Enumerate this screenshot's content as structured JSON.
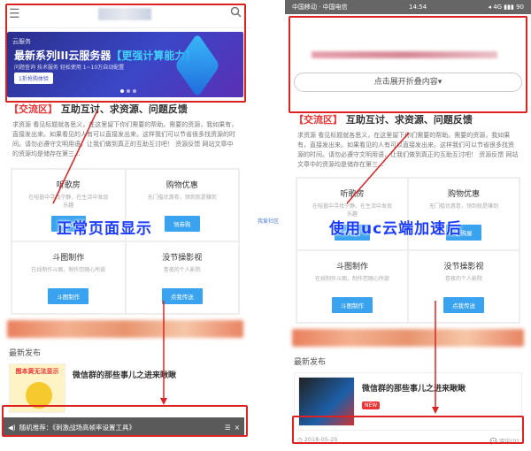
{
  "left": {
    "banner": {
      "logo": "云服务",
      "title_main": "最新系列III云服务器",
      "title_hl": "【更强计算能力】",
      "sub": "问题查询 技术服务 轻松使用 1~10万自动配置",
      "button": "1折抢购体验"
    },
    "section": {
      "tag": "【交流区】",
      "title": "互助互讨、求资源、问题反馈"
    },
    "description": "求资源 看见标题就各思义，在这里留下你们需要的帮助。需要的资源，我如果有，直接发出来。如果看见的人有可以直接发出来。这样我们可以节省很多找资源的时间。请勿必遵守文明用语，让我们做到真正的互助互讨吧！ 资源反馈 网站文章中的资源均是储存在第三...",
    "grid": [
      {
        "title": "听歌房",
        "desc": "在喧嚣中寻找宁静，在生活中发现乐趣",
        "button": "听歌房"
      },
      {
        "title": "购物优惠",
        "desc": "无门槛优惠卷，领到就是赚到",
        "button": "领券购"
      },
      {
        "title": "斗图制作",
        "desc": "在线制作斗图，制作您随心所欲",
        "button": "斗图制作"
      },
      {
        "title": "没节操影视",
        "desc": "卷夜的个人影院",
        "button": "点我传送"
      }
    ],
    "overlay": "正常页面显示",
    "latest_label": "最新发布",
    "post_title": "微信群的那些事儿之进来瞅瞅",
    "thumb_text": "图本黄无法显示",
    "ticker": "随机推荐：《刺激战场高帧率设置工具》",
    "close": "×"
  },
  "mid_label": "我爱社区",
  "right": {
    "status": {
      "carrier": "中国移动 · 中国电信",
      "time": "14:54",
      "icons": "◂ 4G ▮▮▮ 90"
    },
    "expand": "点击展开折叠内容",
    "section": {
      "tag": "【交流区】",
      "title": "互助互讨、求资源、问题反馈"
    },
    "description": "求资源 看见标题就各思义，在这里留下你们需要的帮助。需要的资源，我如果有，直接发出来。如果看见的人有可以直接发出来。这样我们可以节省很多找资源的时间。请勿必遵守文明用语，让我们做到真正的互助互讨吧！ 资源反馈 网站文章中的资源均是储存在第三...",
    "grid": [
      {
        "title": "听歌房",
        "desc": "在喧嚣中寻找宁静，在生活中发现乐趣",
        "button": "听歌房"
      },
      {
        "title": "购物优惠",
        "desc": "无门槛优惠卷，领到就是赚到",
        "button": "爱购屋"
      },
      {
        "title": "斗图制作",
        "desc": "在线制作斗图，制作您随心所欲",
        "button": "斗图制作"
      },
      {
        "title": "没节操影视",
        "desc": "卷夜的个人影院",
        "button": "点我传送"
      }
    ],
    "overlay": "使用uc云端加速后",
    "latest_label": "最新发布",
    "post_title": "微信群的那些事儿之进来瞅瞅",
    "new_badge": "NEW",
    "date": "2018-05-25",
    "comments": "评论(0)"
  },
  "colors": {
    "accent_red": "#dd2222",
    "overlay_blue": "#1b3cff",
    "button_blue": "#3aa3f0"
  }
}
